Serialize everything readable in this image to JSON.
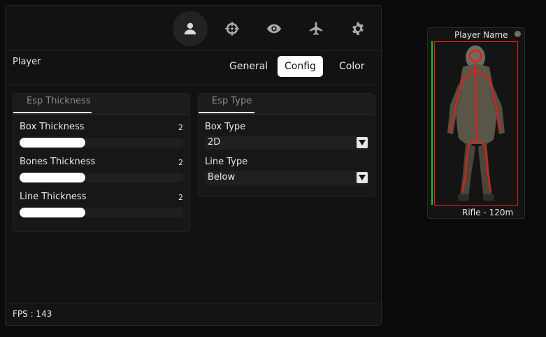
{
  "nav": {
    "icons": [
      "user-icon",
      "crosshair-icon",
      "eye-icon",
      "plane-icon",
      "gear-icon"
    ],
    "active": "user-icon"
  },
  "section_title": "Player",
  "tabs": [
    {
      "label": "General",
      "active": false
    },
    {
      "label": "Config",
      "active": true
    },
    {
      "label": "Color",
      "active": false
    }
  ],
  "esp_thickness": {
    "title": "Esp Thickness",
    "rows": [
      {
        "label": "Box Thickness",
        "value": "2",
        "fill_fraction": 0.4
      },
      {
        "label": "Bones Thickness",
        "value": "2",
        "fill_fraction": 0.4
      },
      {
        "label": "Line Thickness",
        "value": "2",
        "fill_fraction": 0.4
      }
    ]
  },
  "esp_type": {
    "title": "Esp Type",
    "box_type": {
      "label": "Box Type",
      "value": "2D"
    },
    "line_type": {
      "label": "Line Type",
      "value": "Below"
    }
  },
  "fps": "FPS : 143",
  "preview": {
    "player_name": "Player Name",
    "weapon_distance": "Rifle - 120m",
    "health_fraction": 1.0,
    "health_color": "#22c31b",
    "box_color": "#e01e1e",
    "bones_color": "#e01e1e"
  }
}
